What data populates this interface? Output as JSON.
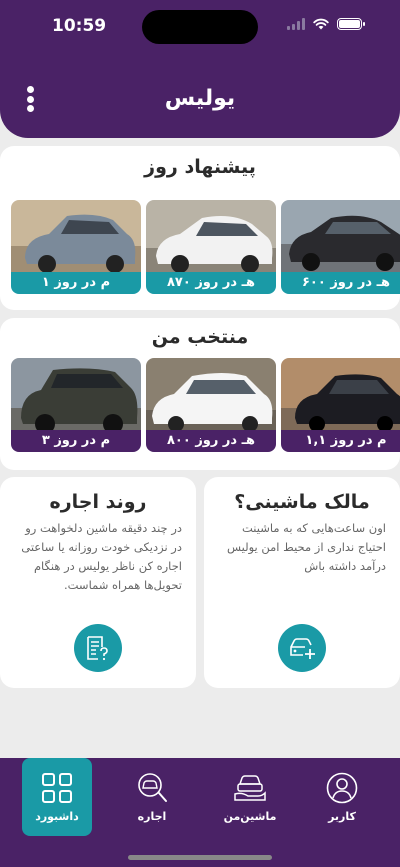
{
  "status_bar": {
    "time": "10:59"
  },
  "header": {
    "logo": "یولیس"
  },
  "offers": {
    "title": "پیشنهاد روز",
    "cars": [
      {
        "price": "۶۰۰ هـ در روز",
        "color": "#2a2a2e"
      },
      {
        "price": "۸۷۰ هـ در روز",
        "color": "#f2f2f2"
      },
      {
        "price": "۱ م در روز",
        "color": "#7b8a9a"
      }
    ]
  },
  "featured": {
    "title": "منتخب من",
    "cars": [
      {
        "price": "۱,۱ م در روز",
        "color": "#1c1c22"
      },
      {
        "price": "۸۰۰ هـ در روز",
        "color": "#f5f5f5"
      },
      {
        "price": "۳ م در روز",
        "color": "#3a3d36"
      }
    ]
  },
  "owner_card": {
    "title": "مالک ماشینی؟",
    "text": "اون ساعت‌هایی که به ماشینت احتیاج نداری از محیط امن یولیس درآمد داشته باش",
    "icon": "car-add-icon"
  },
  "rent_card": {
    "title": "روند اجاره",
    "text": "در چند دقیقه ماشین دلخواهت رو در نزدیکی خودت روزانه یا ساعتی اجاره کن ناظر یولیس در هنگام تحویل‌ها همراه شماست.",
    "icon": "document-question-icon"
  },
  "bottom_nav": {
    "items": [
      {
        "label": "داشبورد",
        "icon": "dashboard-grid-icon",
        "active": true
      },
      {
        "label": "اجاره",
        "icon": "search-car-icon"
      },
      {
        "label": "ماشین‌من",
        "icon": "my-car-icon"
      },
      {
        "label": "کاربر",
        "icon": "user-icon"
      }
    ]
  },
  "colors": {
    "primary": "#4a2266",
    "accent": "#1a9aa6",
    "background": "#ececec"
  }
}
